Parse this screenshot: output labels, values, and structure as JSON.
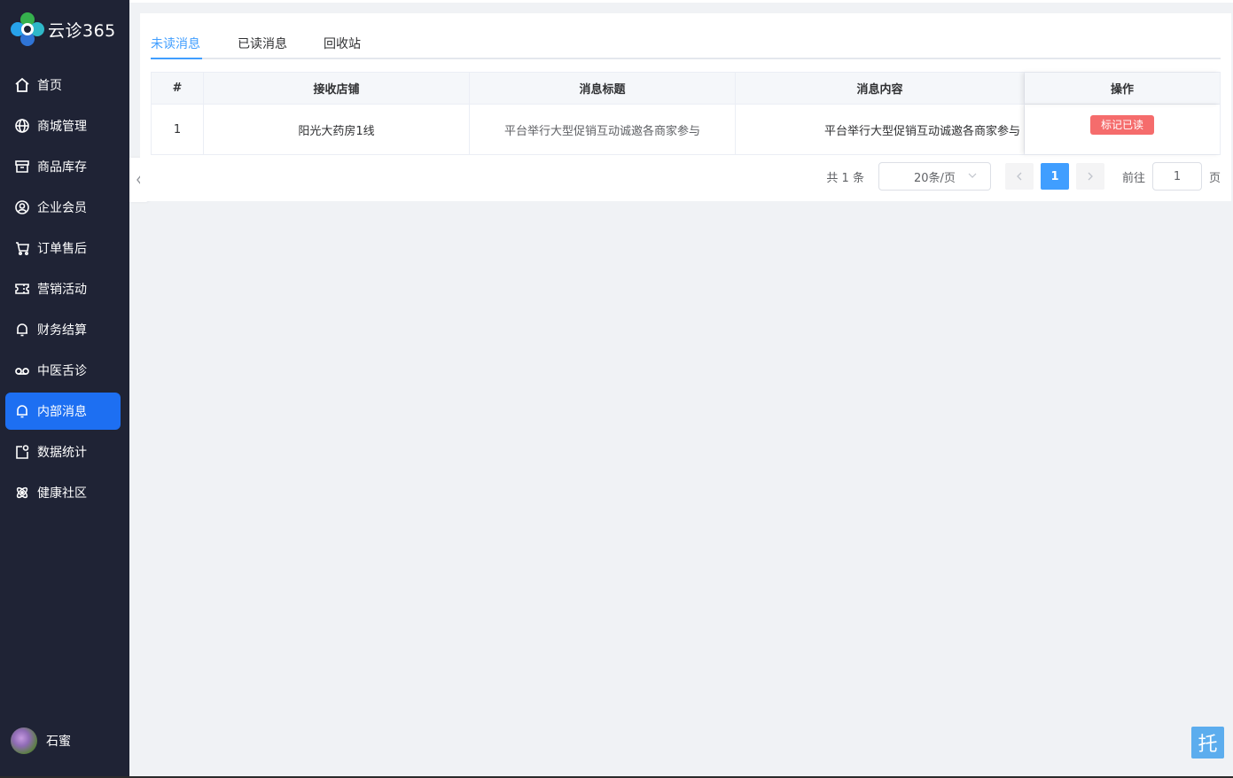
{
  "brand": {
    "name": "云诊365"
  },
  "sidebar": {
    "items": [
      {
        "label": "首页",
        "icon": "home-icon"
      },
      {
        "label": "商城管理",
        "icon": "globe-icon"
      },
      {
        "label": "商品库存",
        "icon": "box-icon"
      },
      {
        "label": "企业会员",
        "icon": "user-circle-icon"
      },
      {
        "label": "订单售后",
        "icon": "cart-icon"
      },
      {
        "label": "营销活动",
        "icon": "ticket-icon"
      },
      {
        "label": "财务结算",
        "icon": "bell-icon"
      },
      {
        "label": "中医舌诊",
        "icon": "voicemail-icon"
      },
      {
        "label": "内部消息",
        "icon": "bell-icon",
        "active": true
      },
      {
        "label": "数据统计",
        "icon": "doc-badge-icon"
      },
      {
        "label": "健康社区",
        "icon": "atom-icon"
      }
    ],
    "user": {
      "name": "石蜜"
    }
  },
  "tabs": [
    {
      "label": "未读消息",
      "active": true
    },
    {
      "label": "已读消息"
    },
    {
      "label": "回收站"
    }
  ],
  "table": {
    "columns": [
      "#",
      "接收店铺",
      "消息标题",
      "消息内容",
      "操作"
    ],
    "rows": [
      {
        "index": "1",
        "shop": "阳光大药房1线",
        "title": "平台举行大型促销互动诚邀各商家参与",
        "content": "平台举行大型促销互动诚邀各商家参与",
        "action": "标记已读"
      }
    ]
  },
  "pagination": {
    "total": "共 1 条",
    "page_size": "20条/页",
    "current_page": "1",
    "goto_label": "前往",
    "goto_value": "1",
    "page_unit": "页"
  },
  "float_button": {
    "label": "托"
  },
  "colors": {
    "sidebar_bg": "#1f2335",
    "active": "#1d6ff2",
    "primary": "#409eff",
    "danger": "#f56c6c"
  }
}
